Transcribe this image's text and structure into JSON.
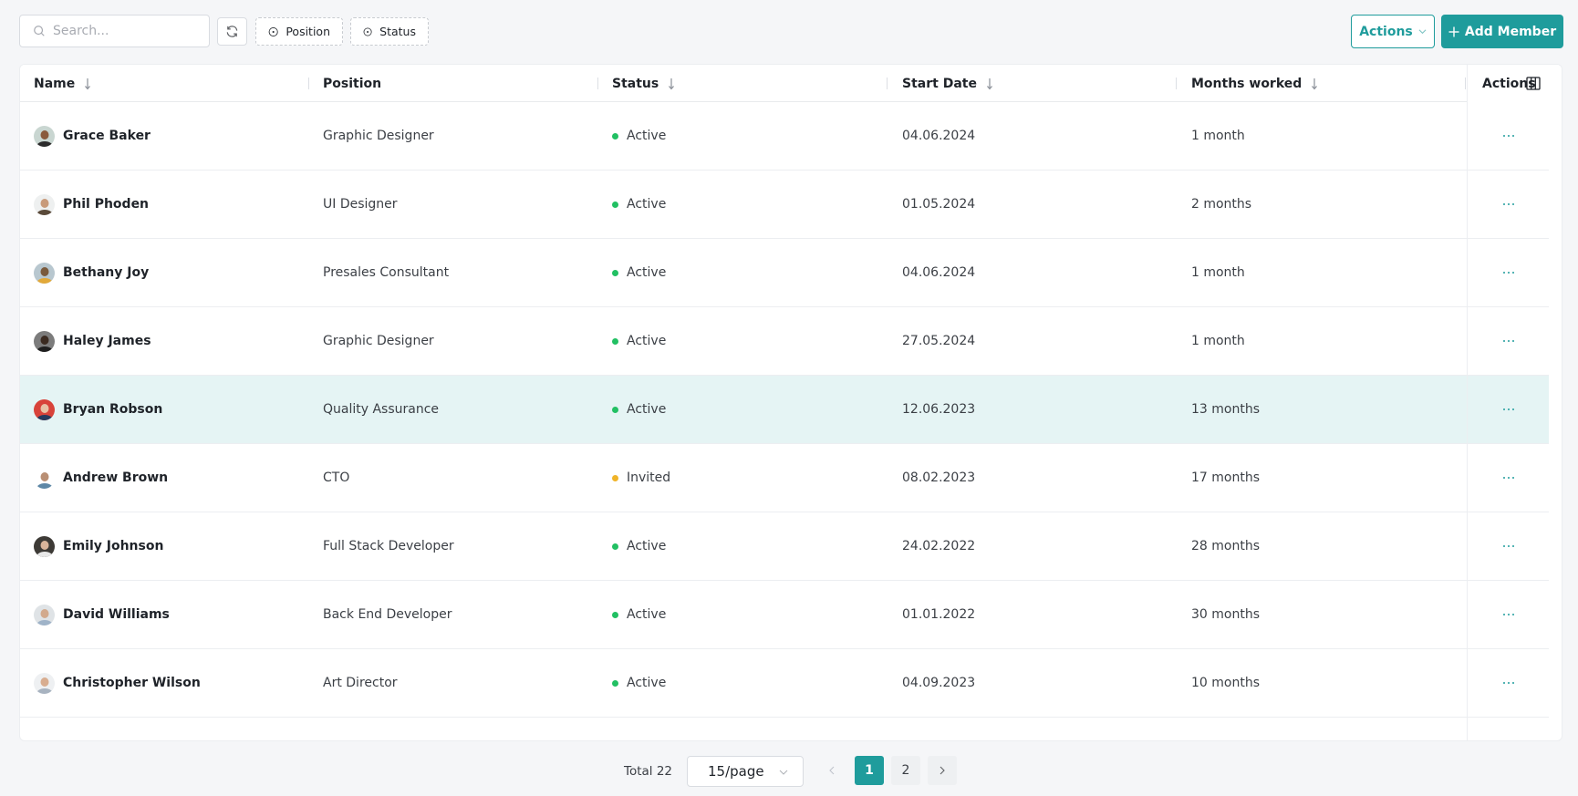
{
  "toolbar": {
    "search_placeholder": "Search...",
    "refresh_icon": "refresh-icon",
    "filters": [
      {
        "label": "Position",
        "icon": "plus-circle-icon"
      },
      {
        "label": "Status",
        "icon": "plus-circle-icon"
      }
    ],
    "actions_label": "Actions",
    "add_member_label": "Add Member"
  },
  "table": {
    "columns": [
      {
        "label": "Name",
        "sortable": true
      },
      {
        "label": "Position",
        "sortable": false
      },
      {
        "label": "Status",
        "sortable": true
      },
      {
        "label": "Start Date",
        "sortable": true
      },
      {
        "label": "Months worked",
        "sortable": true
      },
      {
        "label": "Actions",
        "sortable": false
      }
    ],
    "rows": [
      {
        "name": "Grace Baker",
        "position": "Graphic Designer",
        "status": "Active",
        "start_date": "04.06.2024",
        "months": "1 month",
        "highlighted": false
      },
      {
        "name": "Phil Phoden",
        "position": "UI Designer",
        "status": "Active",
        "start_date": "01.05.2024",
        "months": "2 months",
        "highlighted": false
      },
      {
        "name": "Bethany Joy",
        "position": "Presales Consultant",
        "status": "Active",
        "start_date": "04.06.2024",
        "months": "1 month",
        "highlighted": false
      },
      {
        "name": "Haley James",
        "position": "Graphic Designer",
        "status": "Active",
        "start_date": "27.05.2024",
        "months": "1 month",
        "highlighted": false
      },
      {
        "name": "Bryan Robson",
        "position": "Quality Assurance",
        "status": "Active",
        "start_date": "12.06.2023",
        "months": "13 months",
        "highlighted": true
      },
      {
        "name": "Andrew Brown",
        "position": "CTO",
        "status": "Invited",
        "start_date": "08.02.2023",
        "months": "17 months",
        "highlighted": false
      },
      {
        "name": "Emily Johnson",
        "position": "Full Stack Developer",
        "status": "Active",
        "start_date": "24.02.2022",
        "months": "28 months",
        "highlighted": false
      },
      {
        "name": "David Williams",
        "position": "Back End Developer",
        "status": "Active",
        "start_date": "01.01.2022",
        "months": "30 months",
        "highlighted": false
      },
      {
        "name": "Christopher Wilson",
        "position": "Art Director",
        "status": "Active",
        "start_date": "04.09.2023",
        "months": "10 months",
        "highlighted": false
      }
    ]
  },
  "status_colors": {
    "Active": "#22c063",
    "Invited": "#f0b429"
  },
  "colors": {
    "accent": "#1f9c9c",
    "highlight_row": "#e5f4f4"
  },
  "pagination": {
    "total_label": "Total 22",
    "page_size": "15/page",
    "pages": [
      "1",
      "2"
    ],
    "current_page": "1"
  }
}
